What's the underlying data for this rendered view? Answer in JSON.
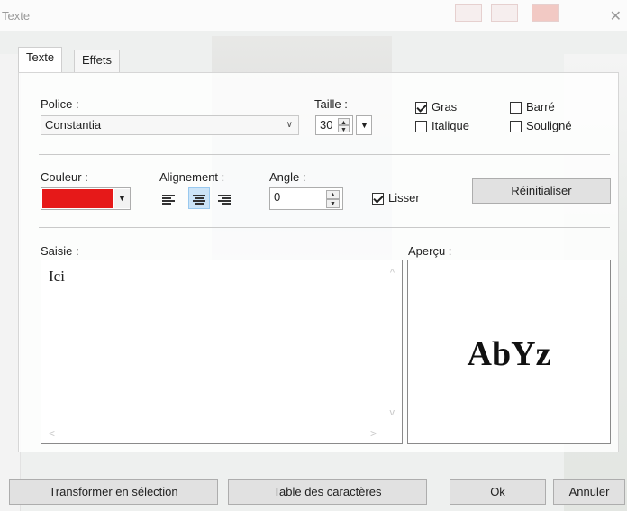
{
  "window": {
    "title": "Texte"
  },
  "tabs": [
    {
      "label": "Texte",
      "active": true
    },
    {
      "label": "Effets",
      "active": false
    }
  ],
  "font": {
    "police_label": "Police :",
    "police_value": "Constantia",
    "taille_label": "Taille :",
    "taille_value": "30"
  },
  "styles": {
    "gras": {
      "label": "Gras",
      "checked": true
    },
    "barre": {
      "label": "Barré",
      "checked": false
    },
    "italique": {
      "label": "Italique",
      "checked": false
    },
    "souligne": {
      "label": "Souligné",
      "checked": false
    }
  },
  "color": {
    "label": "Couleur :",
    "value": "#e61919"
  },
  "alignment": {
    "label": "Alignement :",
    "selected": "center"
  },
  "angle": {
    "label": "Angle :",
    "value": "0"
  },
  "lisser": {
    "label": "Lisser",
    "checked": true
  },
  "reset_button": "Réinitialiser",
  "saisie": {
    "label": "Saisie :",
    "text": "Ici"
  },
  "apercu": {
    "label": "Aperçu :",
    "text": "AbYz"
  },
  "footer": {
    "transform_button": "Transformer en sélection",
    "charmap_button": "Table des caractères",
    "ok_button": "Ok",
    "cancel_button": "Annuler"
  }
}
